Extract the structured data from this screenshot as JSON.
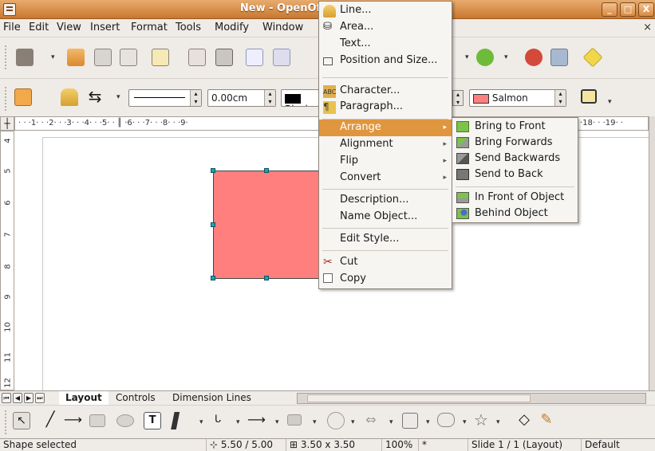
{
  "window": {
    "title": "New - OpenOffice.org Impress",
    "min": "_",
    "max": "□",
    "close": "X"
  },
  "menubar": {
    "items": [
      "File",
      "Edit",
      "View",
      "Insert",
      "Format",
      "Tools",
      "Modify",
      "Window"
    ],
    "close_doc": "×"
  },
  "toolbar2": {
    "line_width": "0.00cm",
    "line_color": "Black",
    "fill_color": "Salmon"
  },
  "ruler": {
    "top_text": "· · ·1· · ·2· · ·3· · ·4· · ·5· · ║ ·6· · ·7· · ·8· · ·9·",
    "top_right": "·18· · ·19· ·",
    "left_numbers": [
      "4",
      "5",
      "6",
      "7",
      "8",
      "9",
      "10",
      "11",
      "12"
    ]
  },
  "context_menu": {
    "items": [
      {
        "label": "Line...",
        "icon": "line-icon"
      },
      {
        "label": "Area...",
        "icon": "area-icon"
      },
      {
        "label": "Text...",
        "icon": ""
      },
      {
        "label": "Position and Size...",
        "icon": "position-size-icon"
      },
      {
        "label": "Character...",
        "icon": "character-icon"
      },
      {
        "label": "Paragraph...",
        "icon": "paragraph-icon"
      },
      {
        "label": "Arrange",
        "submenu": true,
        "highlighted": true
      },
      {
        "label": "Alignment",
        "submenu": true
      },
      {
        "label": "Flip",
        "submenu": true
      },
      {
        "label": "Convert",
        "submenu": true
      },
      {
        "label": "Description..."
      },
      {
        "label": "Name Object..."
      },
      {
        "label": "Edit Style..."
      },
      {
        "label": "Cut",
        "icon": "cut-icon"
      },
      {
        "label": "Copy",
        "icon": "copy-icon"
      }
    ]
  },
  "arrange_submenu": {
    "items": [
      {
        "label": "Bring to Front",
        "icon": "bring-to-front-icon"
      },
      {
        "label": "Bring Forwards",
        "icon": "bring-forwards-icon"
      },
      {
        "label": "Send Backwards",
        "icon": "send-backwards-icon"
      },
      {
        "label": "Send to Back",
        "icon": "send-to-back-icon"
      },
      {
        "label": "In Front of Object",
        "icon": "in-front-of-object-icon"
      },
      {
        "label": "Behind Object",
        "icon": "behind-object-icon"
      }
    ]
  },
  "tabs": [
    "Layout",
    "Controls",
    "Dimension Lines"
  ],
  "statusbar": {
    "message": "Shape selected",
    "position": "5.50 / 5.00",
    "size": "3.50 x 3.50",
    "zoom": "100%",
    "modified": "*",
    "slide": "Slide 1 / 1 (Layout)",
    "style": "Default"
  },
  "colors": {
    "titlebar": "#d4833c",
    "highlight": "#e0963f",
    "shape_fill": "#ff7f7f",
    "salmon": "#ff7f7f"
  }
}
